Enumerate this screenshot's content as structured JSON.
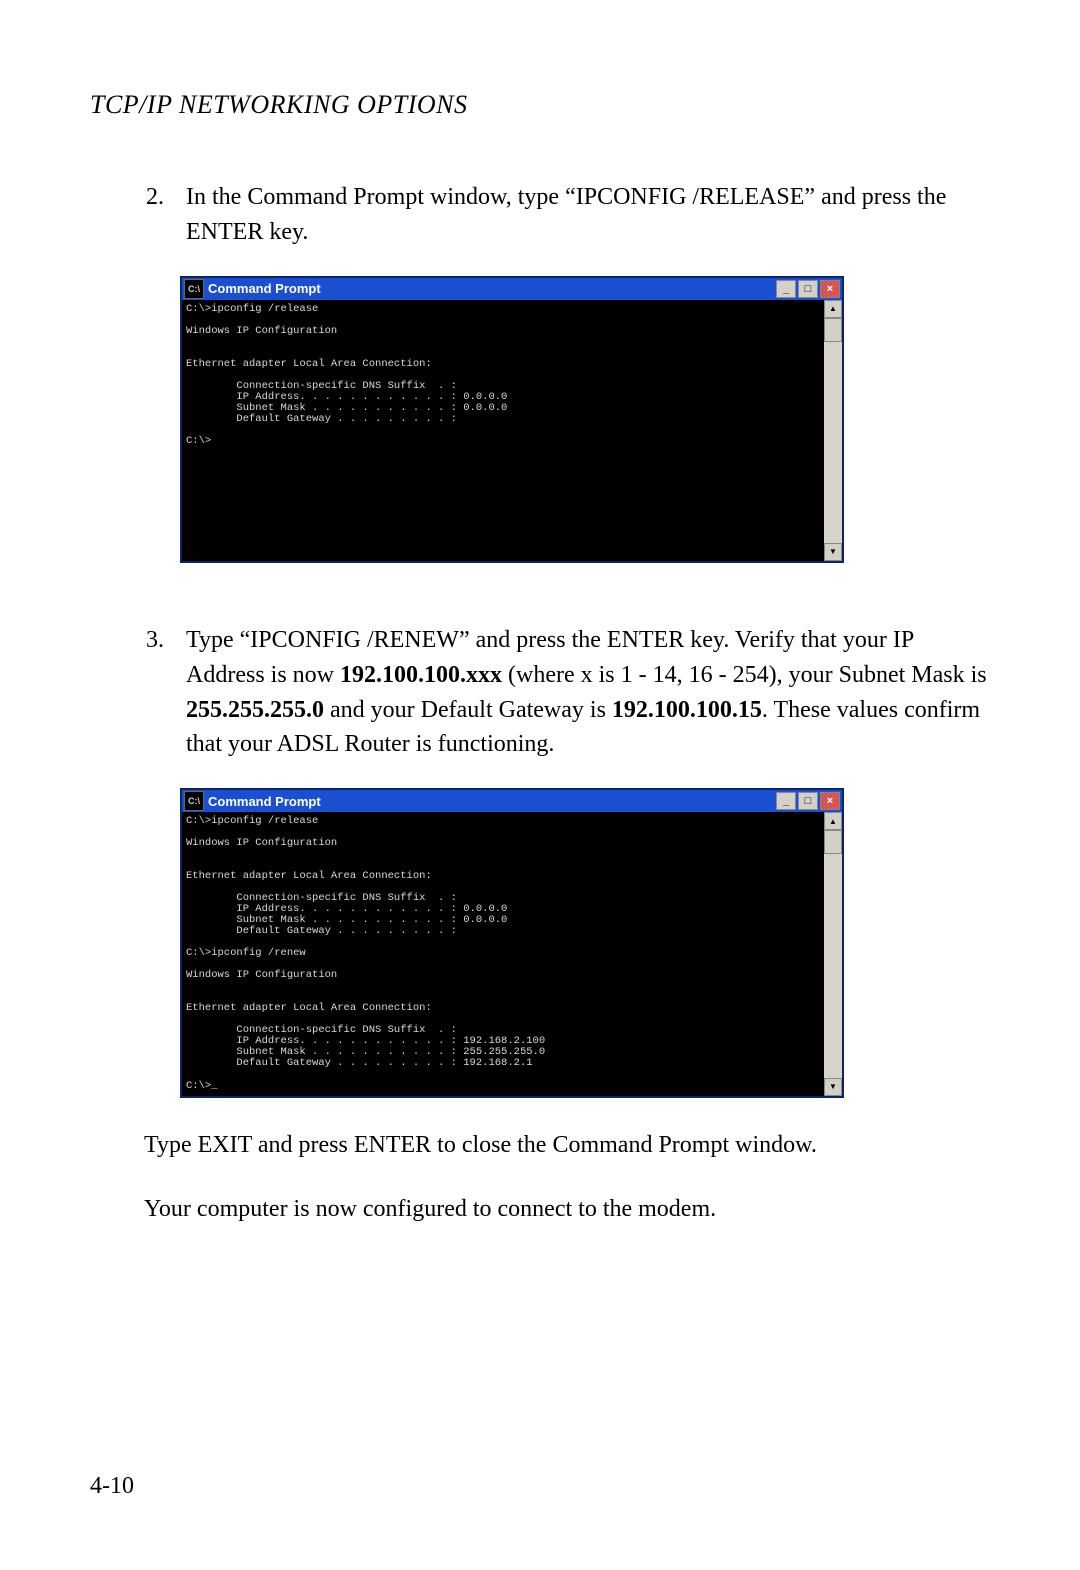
{
  "section_title": "TCP/IP NETWORKING OPTIONS",
  "step2": {
    "num": "2.",
    "text": "In the Command Prompt window, type “IPCONFIG /RELEASE” and press the ENTER key."
  },
  "cmd1": {
    "title": "Command Prompt",
    "lines": "C:\\>ipconfig /release\n\nWindows IP Configuration\n\n\nEthernet adapter Local Area Connection:\n\n        Connection-specific DNS Suffix  . :\n        IP Address. . . . . . . . . . . . : 0.0.0.0\n        Subnet Mask . . . . . . . . . . . : 0.0.0.0\n        Default Gateway . . . . . . . . . :\n\nC:\\>\n\n\n\n\n\n\n\n\n\n\n"
  },
  "step3": {
    "num": "3.",
    "text_a": "Type “IPCONFIG /RENEW” and press the ENTER key. Verify that your IP Address is now ",
    "ip_bold": "192.100.100.xxx",
    "text_b": " (where x is 1 - 14, 16 - 254), your Subnet Mask is ",
    "mask_bold": "255.255.255.0",
    "text_c": " and your Default Gateway is ",
    "gw_bold": "192.100.100.15",
    "text_d": ". These values confirm that your ADSL Router is functioning."
  },
  "cmd2": {
    "title": "Command Prompt",
    "lines": "C:\\>ipconfig /release\n\nWindows IP Configuration\n\n\nEthernet adapter Local Area Connection:\n\n        Connection-specific DNS Suffix  . :\n        IP Address. . . . . . . . . . . . : 0.0.0.0\n        Subnet Mask . . . . . . . . . . . : 0.0.0.0\n        Default Gateway . . . . . . . . . :\n\nC:\\>ipconfig /renew\n\nWindows IP Configuration\n\n\nEthernet adapter Local Area Connection:\n\n        Connection-specific DNS Suffix  . :\n        IP Address. . . . . . . . . . . . : 192.168.2.100\n        Subnet Mask . . . . . . . . . . . : 255.255.255.0\n        Default Gateway . . . . . . . . . : 192.168.2.1\n\nC:\\>_"
  },
  "para1": "Type EXIT and press ENTER to close the Command Prompt window.",
  "para2": "Your computer is now configured to connect to the modem.",
  "page_num": "4-10",
  "window_controls": {
    "min": "_",
    "max": "□",
    "close": "×"
  },
  "icon_label": "C:\\"
}
